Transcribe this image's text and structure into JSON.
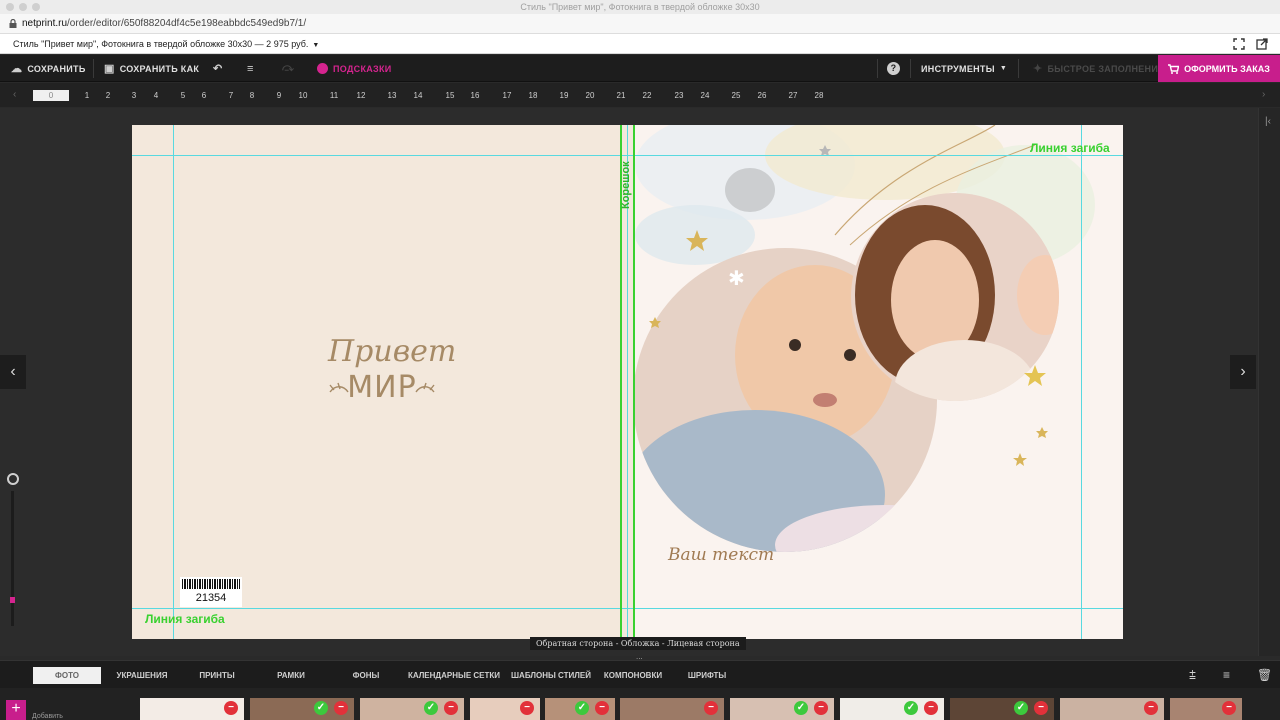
{
  "window": {
    "title": "Стиль \"Привет мир\", Фотокнига в твердой обложке 30x30",
    "url_host": "netprint.ru",
    "url_path": "/order/editor/650f88204df4c5e198eabbdc549ed9b7/1/"
  },
  "product_bar": {
    "title": "Стиль \"Привет мир\", Фотокнига в твердой обложке 30x30 — 2 975 руб.",
    "icons": [
      "fullscreen-icon",
      "open-external-icon"
    ]
  },
  "toolbar": {
    "save_label": "СОХРАНИТЬ",
    "save_as_label": "СОХРАНИТЬ КАК",
    "hints_label": "ПОДСКАЗКИ",
    "tools_label": "ИНСТРУМЕНТЫ",
    "disabled_label": "БЫСТРОЕ ЗАПОЛНЕНИЕ",
    "order_label": "ОФОРМИТЬ ЗАКАЗ",
    "accent_color": "#c81e8c"
  },
  "pages": {
    "active": "0",
    "numbers": [
      "1",
      "2",
      "3",
      "4",
      "5",
      "6",
      "7",
      "8",
      "9",
      "10",
      "11",
      "12",
      "13",
      "14",
      "15",
      "16",
      "17",
      "18",
      "19",
      "20",
      "21",
      "22",
      "23",
      "24",
      "25",
      "26",
      "27",
      "28"
    ]
  },
  "canvas": {
    "spine_label": "Корешок",
    "fold_label_top": "Линия загиба",
    "fold_label_bottom": "Линия загиба",
    "logo_line1": "Привет",
    "logo_line2": "МИР",
    "barcode_number": "21354",
    "placeholder_text": "Ваш текст",
    "guide_color": "#58d9e0",
    "spine_color": "#39d130"
  },
  "status": {
    "breadcrumb": "Обратная сторона - Обложка - Лицевая сторона",
    "more": "..."
  },
  "bottom_tabs": [
    "ФОТО",
    "УКРАШЕНИЯ",
    "ПРИНТЫ",
    "РАМКИ",
    "ФОНЫ",
    "КАЛЕНДАРНЫЕ СЕТКИ",
    "ШАБЛОНЫ СТИЛЕЙ",
    "КОМПОНОВКИ",
    "ШРИФТЫ"
  ],
  "photos": {
    "add_label": "Добавить"
  }
}
